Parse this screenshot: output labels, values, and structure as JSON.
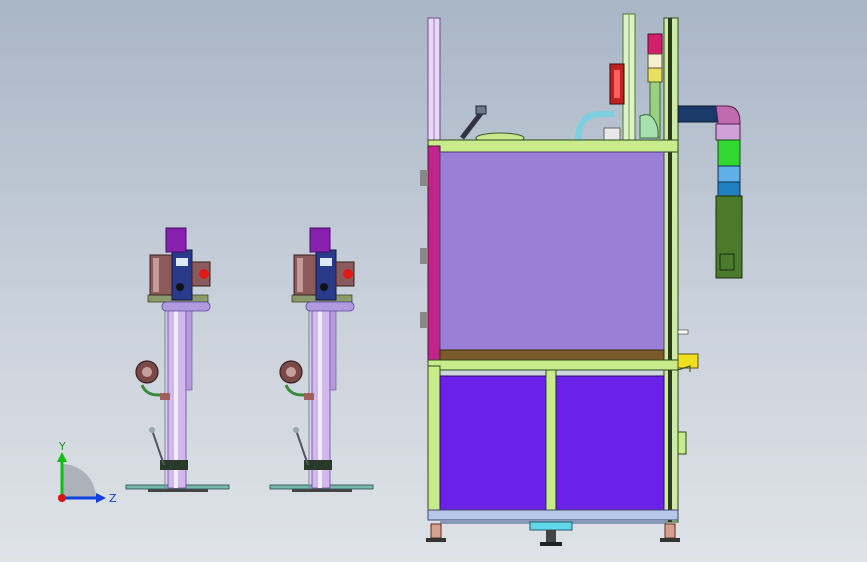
{
  "app": {
    "view": "cad-3d-viewport"
  },
  "triad": {
    "y_label": "Y",
    "z_label": "Z",
    "x_color": "#e01010",
    "y_color": "#10c010",
    "z_color": "#1040e0"
  },
  "colors": {
    "background_top": "#a9b6c6",
    "frame_green": "#b7e36b",
    "panel_upper": "#9b7fd6",
    "panel_lower": "#6a22e8",
    "column_magenta": "#c0248a",
    "pipe_purple": "#c8a6ea",
    "motor_brown": "#8b5a5a",
    "hose_green": "#4a7a2a",
    "hose_blue": "#2080c0",
    "accent_yellow": "#f0e020"
  },
  "models": [
    {
      "name": "stand-assembly-left"
    },
    {
      "name": "stand-assembly-right"
    },
    {
      "name": "cabinet-machine"
    }
  ]
}
